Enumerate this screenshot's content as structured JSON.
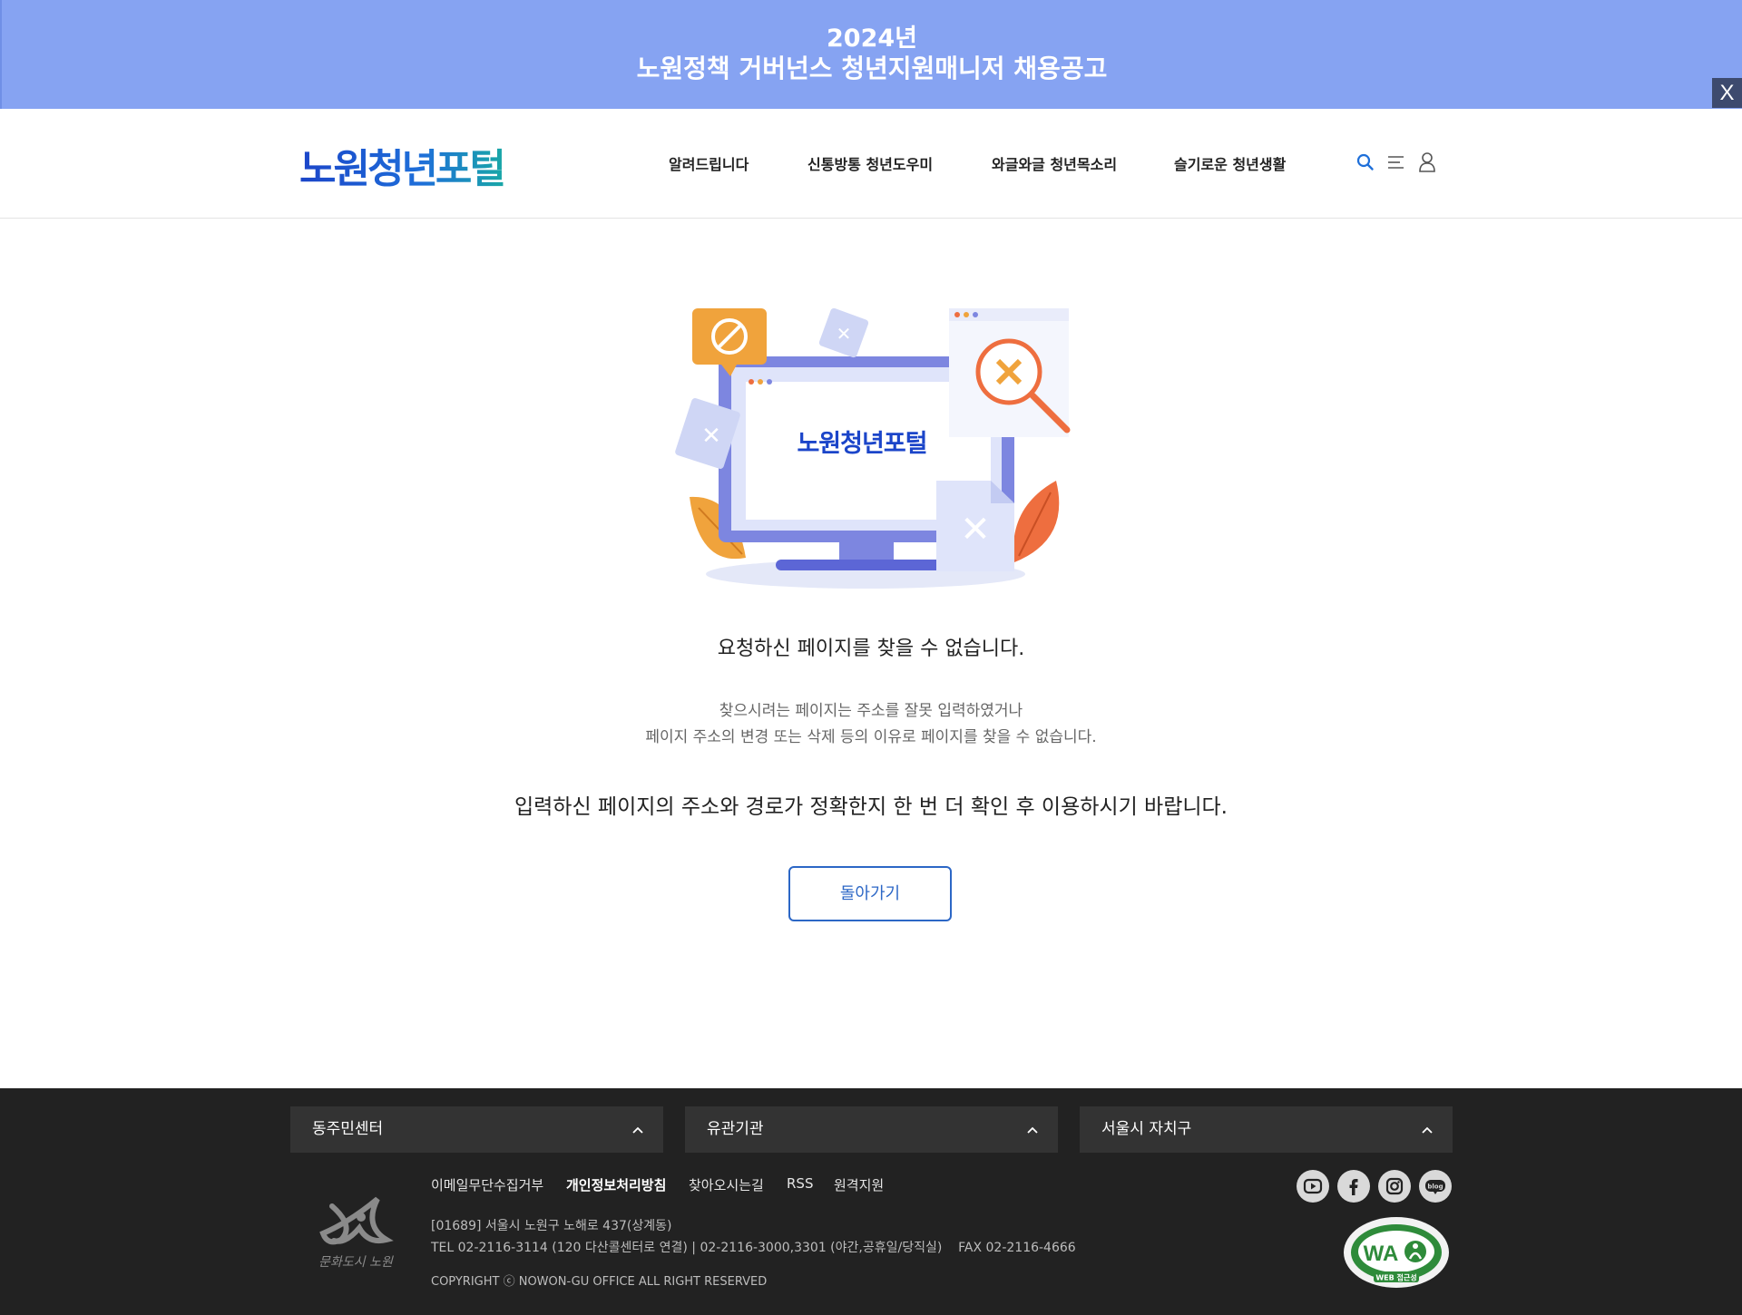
{
  "banner": {
    "year": "2024년",
    "title": "노원정책 거버넌스 청년지원매니저 채용공고",
    "close_label": "X"
  },
  "header": {
    "logo": "노원청년포털",
    "nav": [
      "알려드립니다",
      "신통방통 청년도우미",
      "와글와글 청년목소리",
      "슬기로운 청년생활"
    ],
    "icons": [
      "search-icon",
      "menu-icon",
      "user-icon"
    ]
  },
  "illustration": {
    "screen_logo": "노원청년포털"
  },
  "main": {
    "title": "요청하신 페이지를 찾을 수 없습니다.",
    "desc_line1": "찾으시려는 페이지는 주소를 잘못 입력하였거나",
    "desc_line2": "페이지 주소의 변경 또는 삭제 등의 이유로 페이지를 찾을 수 없습니다.",
    "note": "입력하신 페이지의 주소와 경로가 정확한지 한 번 더 확인 후 이용하시기 바랍니다.",
    "back_button": "돌아가기"
  },
  "footer": {
    "selects": [
      "동주민센터",
      "유관기관",
      "서울시 자치구"
    ],
    "links": [
      {
        "label": "이메일무단수집거부"
      },
      {
        "label": "개인정보처리방침"
      },
      {
        "label": "찾아오시는길"
      },
      {
        "label": "RSS"
      },
      {
        "label": "원격지원"
      }
    ],
    "address": "[01689] 서울시 노원구 노해로 437(상계동)",
    "tel": "TEL 02-2116-3114 (120 다산콜센터로 연결) | 02-2116-3000,3301 (야간,공휴일/당직실)",
    "fax": "FAX 02-2116-4666",
    "copyright": "COPYRIGHT ⓒ NOWON-GU OFFICE ALL RIGHT RESERVED",
    "emblem_text": "문화도시 노원",
    "sns": [
      "youtube-icon",
      "facebook-icon",
      "instagram-icon",
      "blog-icon"
    ],
    "sns_blog_text": "blog",
    "wa_mark": {
      "badge": "WA",
      "caption": "WEB 접근성"
    }
  },
  "colors": {
    "banner_bg": "#86a3f2",
    "brand_blue": "#2c67c6",
    "footer_bg": "#222222",
    "footer_select_bg": "#333333"
  }
}
